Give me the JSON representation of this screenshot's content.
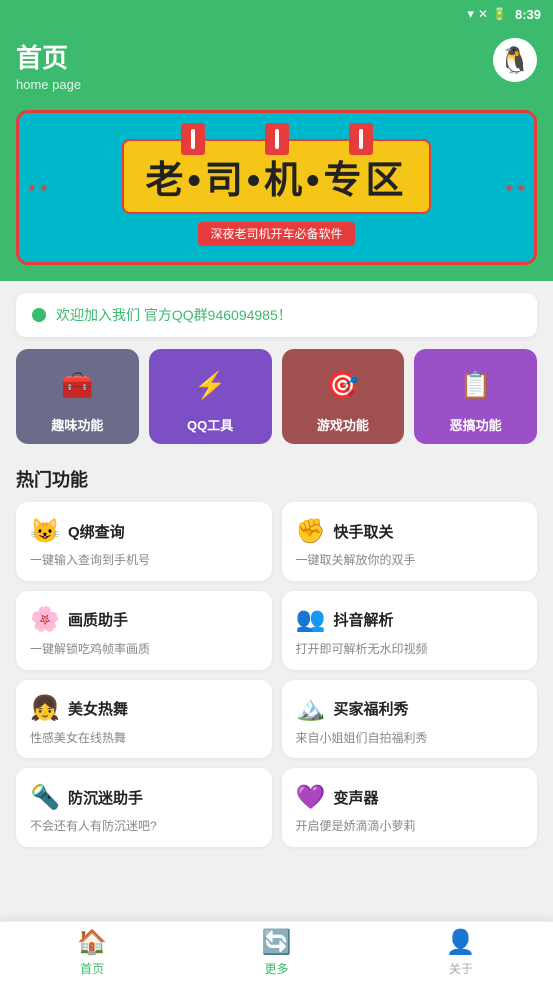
{
  "statusBar": {
    "time": "8:39",
    "icons": [
      "wifi",
      "signal",
      "battery"
    ]
  },
  "header": {
    "title": "首页",
    "subtitle": "home page",
    "avatarIcon": "🐧"
  },
  "banner": {
    "mainText": "老•司•机•专区",
    "subText": "深夜老司机开车必备软件",
    "dots": [
      "",
      "",
      ""
    ]
  },
  "notice": {
    "text": "欢迎加入我们 官方QQ群946094985！"
  },
  "categories": [
    {
      "id": "fun",
      "label": "趣味功能",
      "icon": "🧰",
      "color": "#6b6b8a"
    },
    {
      "id": "qq",
      "label": "QQ工具",
      "icon": "⚡",
      "color": "#7c4fc4"
    },
    {
      "id": "game",
      "label": "游戏功能",
      "icon": "🎯",
      "color": "#a05050"
    },
    {
      "id": "prank",
      "label": "恶搞功能",
      "icon": "📋",
      "color": "#9c50c8"
    }
  ],
  "hotSection": {
    "title": "热门功能"
  },
  "features": [
    {
      "id": "q-bind",
      "icon": "😺",
      "name": "Q绑查询",
      "desc": "一键输入查询到手机号"
    },
    {
      "id": "kuaishou",
      "icon": "✊",
      "name": "快手取关",
      "desc": "一键取关解放你的双手"
    },
    {
      "id": "graphics",
      "icon": "🌸",
      "name": "画质助手",
      "desc": "一键解锁吃鸡帧率画质"
    },
    {
      "id": "douyin",
      "icon": "👥",
      "name": "抖音解析",
      "desc": "打开即可解析无水印视频"
    },
    {
      "id": "beauty-dance",
      "icon": "👧",
      "name": "美女热舞",
      "desc": "性感美女在线热舞"
    },
    {
      "id": "buyer-show",
      "icon": "🏔️",
      "name": "买家福利秀",
      "desc": "来自小姐姐们自拍福利秀"
    },
    {
      "id": "anti-sink",
      "icon": "🔦",
      "name": "防沉迷助手",
      "desc": "不会还有人有防沉迷吧?"
    },
    {
      "id": "voice-changer",
      "icon": "💜",
      "name": "变声器",
      "desc": "开启便是娇滴滴小萝莉"
    }
  ],
  "bottomNav": [
    {
      "id": "home",
      "label": "首页",
      "icon": "🏠",
      "active": true
    },
    {
      "id": "more",
      "label": "更多",
      "icon": "🔄",
      "active": false
    },
    {
      "id": "about",
      "label": "关于",
      "icon": "👤",
      "active": false
    }
  ]
}
